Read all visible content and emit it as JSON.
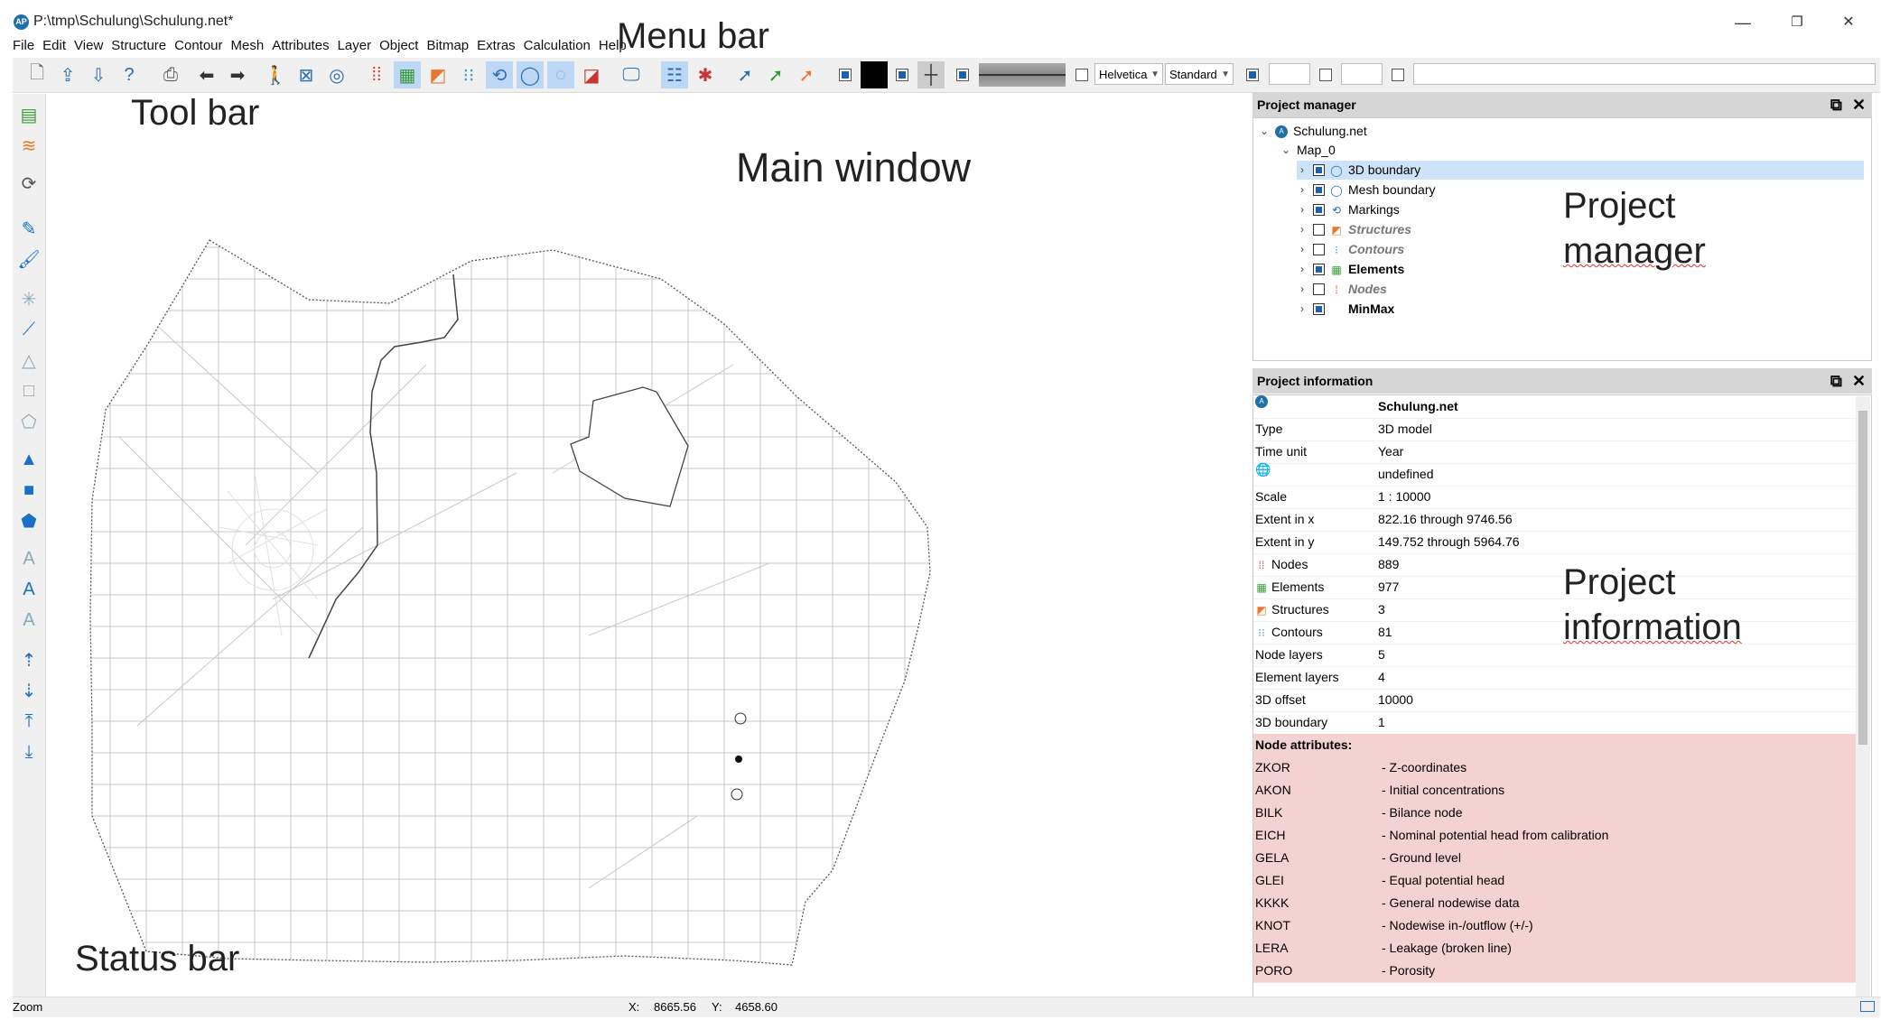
{
  "window": {
    "title": "P:\\tmp\\Schulung\\Schulung.net*",
    "minimize": "—",
    "restore": "❐",
    "close": "✕"
  },
  "menu": [
    "File",
    "Edit",
    "View",
    "Structure",
    "Contour",
    "Mesh",
    "Attributes",
    "Layer",
    "Object",
    "Bitmap",
    "Extras",
    "Calculation",
    "Help"
  ],
  "toolbar": {
    "font": "Helvetica",
    "style": "Standard",
    "color_swatch": "#000000"
  },
  "callouts": {
    "menu_bar": "Menu bar",
    "tool_bar": "Tool bar",
    "main_window": "Main window",
    "project_manager_1": "Project",
    "project_manager_2": "manager",
    "project_information_1": "Project",
    "project_information_2": "information",
    "status_bar": "Status bar"
  },
  "project_manager": {
    "header": "Project manager",
    "root": "Schulung.net",
    "map": "Map_0",
    "layers": [
      {
        "label": "3D boundary",
        "checked": true,
        "style": "normal",
        "icon": "boundary-icon"
      },
      {
        "label": "Mesh boundary",
        "checked": true,
        "style": "normal",
        "icon": "boundary-icon"
      },
      {
        "label": "Markings",
        "checked": true,
        "style": "normal",
        "icon": "markings-icon"
      },
      {
        "label": "Structures",
        "checked": false,
        "style": "italic",
        "icon": "structures-icon"
      },
      {
        "label": "Contours",
        "checked": false,
        "style": "italic",
        "icon": "contours-icon"
      },
      {
        "label": "Elements",
        "checked": true,
        "style": "bold",
        "icon": "elements-icon"
      },
      {
        "label": "Nodes",
        "checked": false,
        "style": "italic",
        "icon": "nodes-icon"
      },
      {
        "label": "MinMax",
        "checked": true,
        "style": "bold",
        "icon": ""
      }
    ]
  },
  "project_information": {
    "header": "Project information",
    "rows": [
      {
        "k": "",
        "v": "Schulung.net",
        "icon": "app-icon"
      },
      {
        "k": "Type",
        "v": "3D model"
      },
      {
        "k": "Time unit",
        "v": "Year"
      },
      {
        "k": "",
        "v": "undefined",
        "icon": "globe-icon"
      },
      {
        "k": "Scale",
        "v": "1 : 10000"
      },
      {
        "k": "Extent in x",
        "v": "822.16 through 9746.56"
      },
      {
        "k": "Extent in y",
        "v": "149.752 through 5964.76"
      },
      {
        "k": "Nodes",
        "v": "889",
        "icon": "nodes-icon"
      },
      {
        "k": "Elements",
        "v": "977",
        "icon": "elements-icon"
      },
      {
        "k": "Structures",
        "v": "3",
        "icon": "structures-icon"
      },
      {
        "k": "Contours",
        "v": "81",
        "icon": "contours-icon"
      },
      {
        "k": "Node layers",
        "v": "5"
      },
      {
        "k": "Element layers",
        "v": "4"
      },
      {
        "k": "3D offset",
        "v": "10000"
      },
      {
        "k": "3D boundary",
        "v": "1"
      }
    ],
    "attributes_title": "Node attributes:",
    "attributes": [
      {
        "k": "ZKOR",
        "v": "- Z-coordinates"
      },
      {
        "k": "AKON",
        "v": "- Initial concentrations"
      },
      {
        "k": "BILK",
        "v": "- Bilance node"
      },
      {
        "k": "EICH",
        "v": "- Nominal potential head from calibration"
      },
      {
        "k": "GELA",
        "v": "- Ground level"
      },
      {
        "k": "GLEI",
        "v": "- Equal potential head"
      },
      {
        "k": "KKKK",
        "v": "- General nodewise data"
      },
      {
        "k": "KNOT",
        "v": "- Nodewise in-/outflow (+/-)"
      },
      {
        "k": "LERA",
        "v": "- Leakage (broken line)"
      },
      {
        "k": "PORO",
        "v": "- Porosity"
      }
    ]
  },
  "status": {
    "mode": "Zoom",
    "x_label": "X:",
    "x": "8665.56",
    "y_label": "Y:",
    "y": "4658.60"
  }
}
